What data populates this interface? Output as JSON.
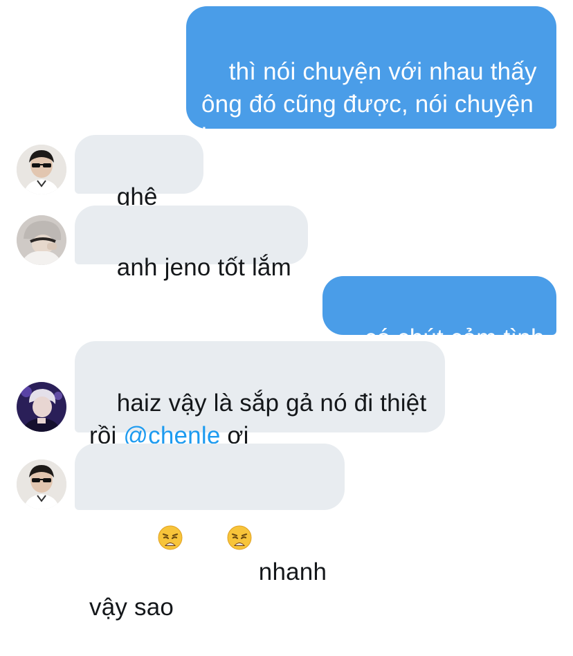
{
  "messages": [
    {
      "from": "me",
      "text": "thì nói chuyện với nhau thấy ông đó cũng được, nói chuyện hợp"
    },
    {
      "from": "other",
      "avatar": "avatar-sunglasses",
      "text": "ghê ghê"
    },
    {
      "from": "other",
      "avatar": "avatar-beanie",
      "text": "anh jeno tốt lắm"
    },
    {
      "from": "me",
      "text": "có chút cảm tình"
    },
    {
      "from": "other",
      "avatar": "avatar-purple-hair",
      "text_before": "haiz vậy là sắp gả nó đi thiệt rồi ",
      "mention": "@chenle",
      "text_after": " ơi"
    },
    {
      "from": "other",
      "avatar": "avatar-sunglasses",
      "emojis": [
        "weary-face",
        "weary-face"
      ],
      "text": "nhanh vậy sao"
    }
  ],
  "colors": {
    "outgoing_bubble": "#4a9de8",
    "incoming_bubble": "#e8ecf0",
    "mention": "#1d9bf0",
    "text_dark": "#14171a",
    "text_light": "#ffffff"
  }
}
